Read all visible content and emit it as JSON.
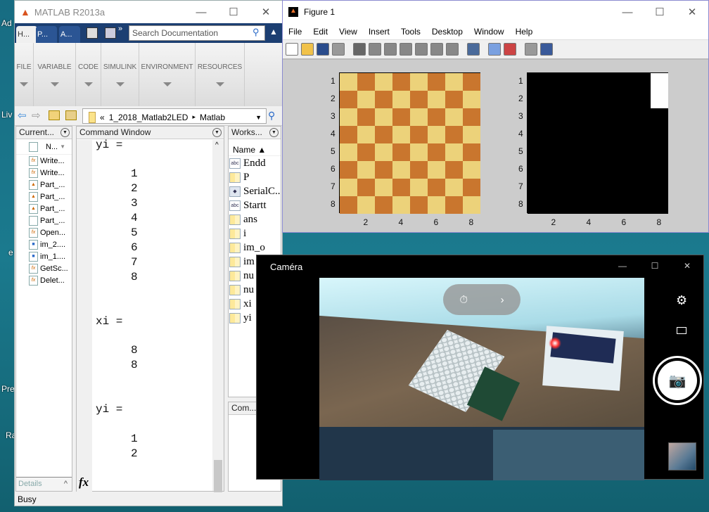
{
  "desktop": {
    "icon_labels": [
      "Ad",
      "Liv",
      "e",
      "Pre",
      "Ra"
    ]
  },
  "matlab": {
    "title": "MATLAB R2013a",
    "tabs": [
      "H...",
      "P...",
      "A..."
    ],
    "search_placeholder": "Search Documentation",
    "toolstrip_sections": [
      "FILE",
      "VARIABLE",
      "CODE",
      "SIMULINK",
      "ENVIRONMENT",
      "RESOURCES"
    ],
    "address": {
      "prefix": "«",
      "folder": "1_2018_Matlab2LED",
      "sep": "▸",
      "current": "Matlab"
    },
    "current_folder": {
      "title": "Current...",
      "column": "N...",
      "files": [
        {
          "name": "Write...",
          "type": "function"
        },
        {
          "name": "Write...",
          "type": "function"
        },
        {
          "name": "Part_...",
          "type": "model"
        },
        {
          "name": "Part_...",
          "type": "model"
        },
        {
          "name": "Part_...",
          "type": "model"
        },
        {
          "name": "Part_...",
          "type": "file"
        },
        {
          "name": "Open...",
          "type": "function"
        },
        {
          "name": "im_2....",
          "type": "image"
        },
        {
          "name": "im_1....",
          "type": "image"
        },
        {
          "name": "GetSc...",
          "type": "function"
        },
        {
          "name": "Delet...",
          "type": "function"
        }
      ],
      "details_label": "Details"
    },
    "command_window": {
      "title": "Command Window",
      "lines": [
        {
          "text": "yi =",
          "indent": false
        },
        {
          "text": "1",
          "indent": true
        },
        {
          "text": "2",
          "indent": true
        },
        {
          "text": "3",
          "indent": true
        },
        {
          "text": "4",
          "indent": true
        },
        {
          "text": "5",
          "indent": true
        },
        {
          "text": "6",
          "indent": true
        },
        {
          "text": "7",
          "indent": true
        },
        {
          "text": "8",
          "indent": true
        },
        {
          "text": "xi =",
          "indent": false
        },
        {
          "text": "8",
          "indent": true
        },
        {
          "text": "8",
          "indent": true
        },
        {
          "text": "yi =",
          "indent": false
        },
        {
          "text": "1",
          "indent": true
        },
        {
          "text": "2",
          "indent": true
        }
      ],
      "fx": "fx"
    },
    "workspace": {
      "title": "Works...",
      "column": "Name ▲",
      "vars": [
        {
          "name": "Endd",
          "type": "abc"
        },
        {
          "name": "P",
          "type": "matrix"
        },
        {
          "name": "SerialC...",
          "type": "object"
        },
        {
          "name": "Startt",
          "type": "abc"
        },
        {
          "name": "ans",
          "type": "matrix"
        },
        {
          "name": "i",
          "type": "matrix"
        },
        {
          "name": "im_o",
          "type": "matrix"
        },
        {
          "name": "im",
          "type": "matrix"
        },
        {
          "name": "nu",
          "type": "matrix"
        },
        {
          "name": "nu",
          "type": "matrix"
        },
        {
          "name": "xi",
          "type": "matrix"
        },
        {
          "name": "yi",
          "type": "matrix"
        }
      ]
    },
    "command_history": {
      "title": "Com..."
    },
    "status": "Busy"
  },
  "figure": {
    "title": "Figure 1",
    "menu": [
      "File",
      "Edit",
      "View",
      "Insert",
      "Tools",
      "Desktop",
      "Window",
      "Help"
    ],
    "toolbar_icons": [
      "new-icon",
      "open-icon",
      "save-icon",
      "print-icon",
      "pointer-icon",
      "zoom-in-icon",
      "zoom-out-icon",
      "pan-icon",
      "rotate-icon",
      "data-cursor-icon",
      "brush-icon",
      "link-icon",
      "colorbar-icon",
      "legend-icon",
      "hide-plot-tools-icon",
      "show-plot-tools-icon"
    ],
    "axes": [
      {
        "xticks": [
          "2",
          "4",
          "6",
          "8"
        ],
        "yticks": [
          "1",
          "2",
          "3",
          "4",
          "5",
          "6",
          "7",
          "8"
        ],
        "colors": {
          "light": "#ecd27a",
          "dark": "#c9762e"
        },
        "pattern": "checkerboard"
      },
      {
        "xticks": [
          "2",
          "4",
          "6",
          "8"
        ],
        "yticks": [
          "1",
          "2",
          "3",
          "4",
          "5",
          "6",
          "7",
          "8"
        ],
        "colors": {
          "on": "#ffffff",
          "off": "#000000"
        },
        "lit_cells": [
          [
            1,
            8
          ],
          [
            2,
            8
          ]
        ]
      }
    ]
  },
  "camera": {
    "title": "Caméra",
    "timer_icon": "timer-off-icon",
    "controls": [
      "settings-icon",
      "video-icon",
      "photo-capture-icon"
    ]
  }
}
